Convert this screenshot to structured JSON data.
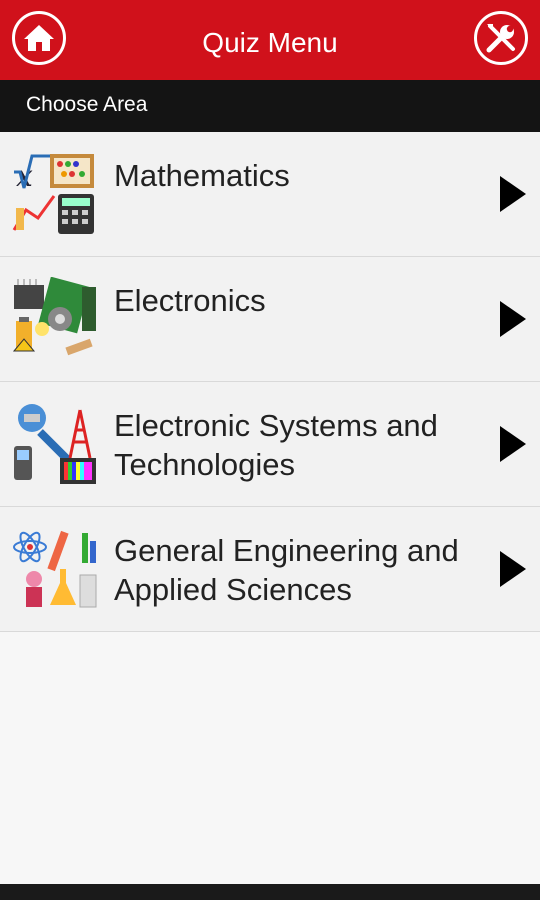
{
  "header": {
    "title": "Quiz Menu",
    "home_icon": "home-icon",
    "tools_icon": "tools-icon",
    "bar_color": "#d0111b"
  },
  "subheader": {
    "title": "Choose Area"
  },
  "areas": [
    {
      "label": "Mathematics",
      "icon": "math-icon"
    },
    {
      "label": "Electronics",
      "icon": "electronics-icon"
    },
    {
      "label": "Electronic Systems and Technologies",
      "icon": "telecom-icon"
    },
    {
      "label": "General Engineering and Applied Sciences",
      "icon": "engineering-icon"
    }
  ]
}
